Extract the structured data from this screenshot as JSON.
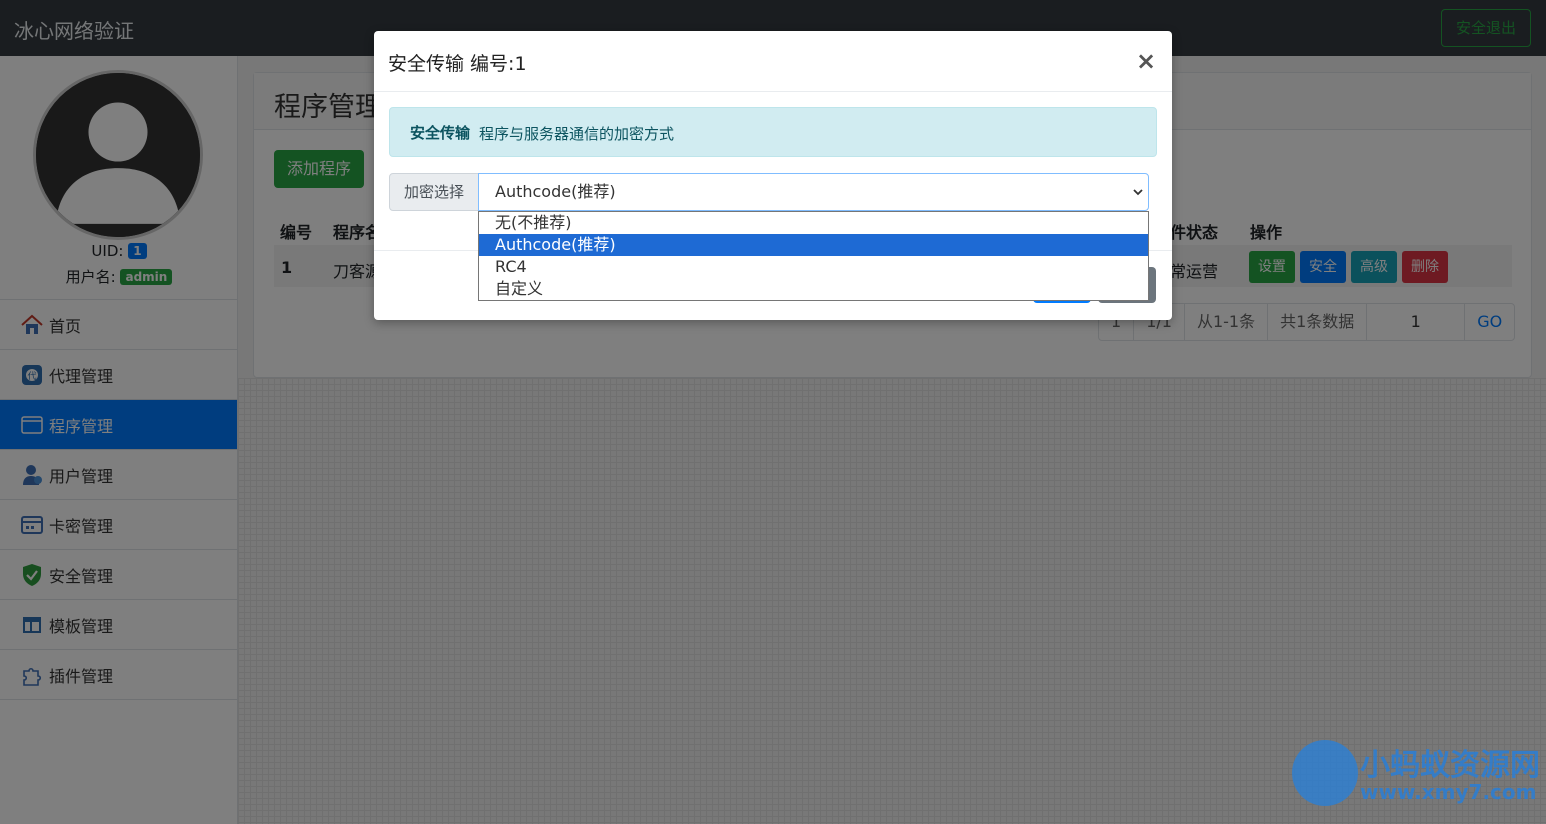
{
  "navbar": {
    "brand": "冰心网络验证",
    "logout_label": "安全退出"
  },
  "sidebar": {
    "uid_label": "UID:",
    "uid_value": "1",
    "username_label": "用户名:",
    "username_value": "admin",
    "items": [
      {
        "label": "首页",
        "icon": "home-icon"
      },
      {
        "label": "代理管理",
        "icon": "agent-icon"
      },
      {
        "label": "程序管理",
        "icon": "program-icon",
        "active": true
      },
      {
        "label": "用户管理",
        "icon": "user-icon"
      },
      {
        "label": "卡密管理",
        "icon": "card-icon"
      },
      {
        "label": "安全管理",
        "icon": "shield-icon"
      },
      {
        "label": "模板管理",
        "icon": "template-icon"
      },
      {
        "label": "插件管理",
        "icon": "puzzle-icon"
      }
    ]
  },
  "main": {
    "title": "程序管理",
    "add_button": "添加程序",
    "table": {
      "headers": [
        "编号",
        "程序名",
        "件状态",
        "操作"
      ],
      "rows": [
        {
          "id": "1",
          "name": "刀客源",
          "status": "常运营"
        }
      ],
      "actions": [
        "设置",
        "安全",
        "高级",
        "删除"
      ]
    },
    "pager": {
      "page": "1",
      "total_pages": "1/1",
      "range": "从1-1条",
      "total": "共1条数据",
      "goto_value": "1",
      "go_label": "GO"
    }
  },
  "modal": {
    "title": "安全传输 编号:1",
    "close": "×",
    "alert_strong": "安全传输",
    "alert_text": "程序与服务器通信的加密方式",
    "select_label": "加密选择",
    "selected_value": "Authcode(推荐)",
    "options": [
      "无(不推荐)",
      "Authcode(推荐)",
      "RC4",
      "自定义"
    ]
  },
  "watermark": {
    "title": "小蚂蚁资源网",
    "url": "www.xmy7.com"
  }
}
